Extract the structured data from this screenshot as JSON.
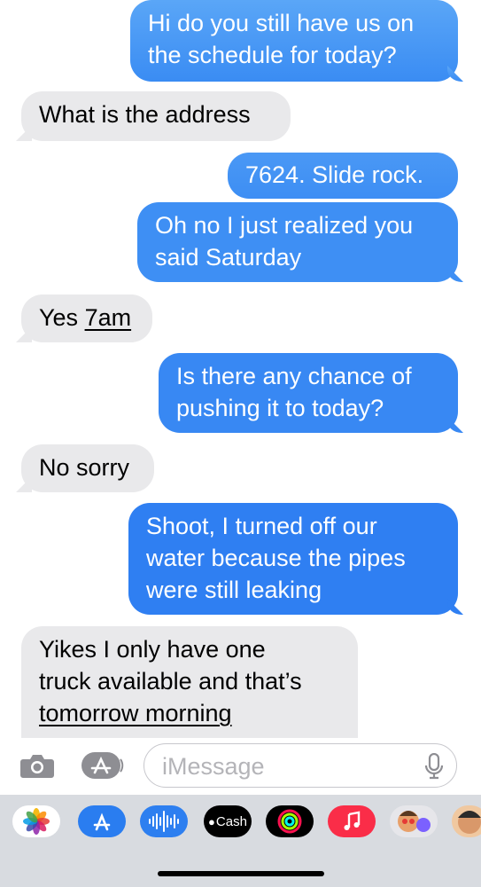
{
  "messages": [
    {
      "from": "me",
      "lines": [
        "Hi do you still have us on",
        "the schedule for today?"
      ]
    },
    {
      "from": "them",
      "lines": [
        "What is the address"
      ]
    },
    {
      "from": "me",
      "lines": [
        "7624. Slide rock."
      ]
    },
    {
      "from": "me",
      "lines": [
        "Oh no I just realized you",
        "said Saturday"
      ]
    },
    {
      "from": "them",
      "prefix": "Yes ",
      "link": "7am"
    },
    {
      "from": "me",
      "lines": [
        "Is there any chance of",
        "pushing it to today?"
      ]
    },
    {
      "from": "them",
      "lines": [
        "No sorry"
      ]
    },
    {
      "from": "me",
      "lines": [
        "Shoot, I turned off our",
        "water because the pipes",
        "were still leaking"
      ]
    },
    {
      "from": "them",
      "lines": [
        "Yikes I only have one",
        "truck available and that’s"
      ],
      "link": "tomorrow morning"
    }
  ],
  "composer": {
    "placeholder": "iMessage"
  },
  "app_tray": {
    "cash_label": "Cash",
    "apps": [
      "photos-icon",
      "app-store-icon",
      "audio-messages-icon",
      "apple-cash-icon",
      "activity-icon",
      "music-icon",
      "memoji-icon",
      "memoji-icon-2"
    ]
  },
  "colors": {
    "sent": "#2f7ff2",
    "received": "#e9e9eb",
    "tray": "#d8dbe0"
  }
}
